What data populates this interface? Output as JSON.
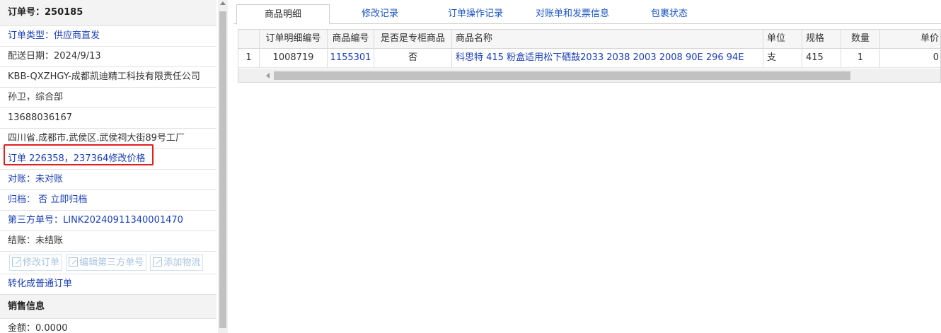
{
  "order": {
    "title": "订单号：250185",
    "type": "订单类型：供应商直发",
    "delivery_date": "配送日期：2024/9/13",
    "company": "KBB-QXZHGY-成都凯迪精工科技有限责任公司",
    "contact": "孙卫，综合部",
    "phone": "13688036167",
    "address": "四川省.成都市.武侯区.武侯祠大街89号工厂",
    "note": "订单 226358，237364修改价格",
    "reconcile": "对账：未对账",
    "archive_label": "归档：",
    "archive_value": "否",
    "archive_action": "立即归档",
    "third_party": "第三方单号：LINK20240911340001470",
    "settle": "结账：未结账",
    "buttons": {
      "edit_order": "修改订单",
      "edit_third": "编辑第三方单号",
      "add_logistics": "添加物流"
    },
    "convert": "转化成普通订单"
  },
  "sales": {
    "section_title": "销售信息",
    "amount": "金额：0.0000"
  },
  "tabs": [
    "商品明细",
    "修改记录",
    "订单操作记录",
    "对账单和发票信息",
    "包裹状态"
  ],
  "grid": {
    "columns": [
      "订单明细编号",
      "商品编号",
      "是否是专柜商品",
      "商品名称",
      "单位",
      "规格",
      "数量",
      "单价"
    ],
    "rows": [
      {
        "index": "1",
        "detail_id": "1008719",
        "product_id": "1155301",
        "is_counter": "否",
        "name": "科思特 415 粉盒适用松下硒鼓2033 2038 2003 2008 90E 296 94E",
        "unit": "支",
        "spec": "415",
        "qty": "1",
        "price": "0"
      }
    ]
  },
  "icons": {
    "edit": "edit-icon",
    "scroll_up": "scroll-up-arrow-icon",
    "scroll_left": "scroll-left-arrow-icon"
  },
  "colors": {
    "link": "#1a3fb5",
    "tab_link": "#1a56c4",
    "highlight": "#e02020",
    "disabled_button": "#a8c4e0"
  }
}
